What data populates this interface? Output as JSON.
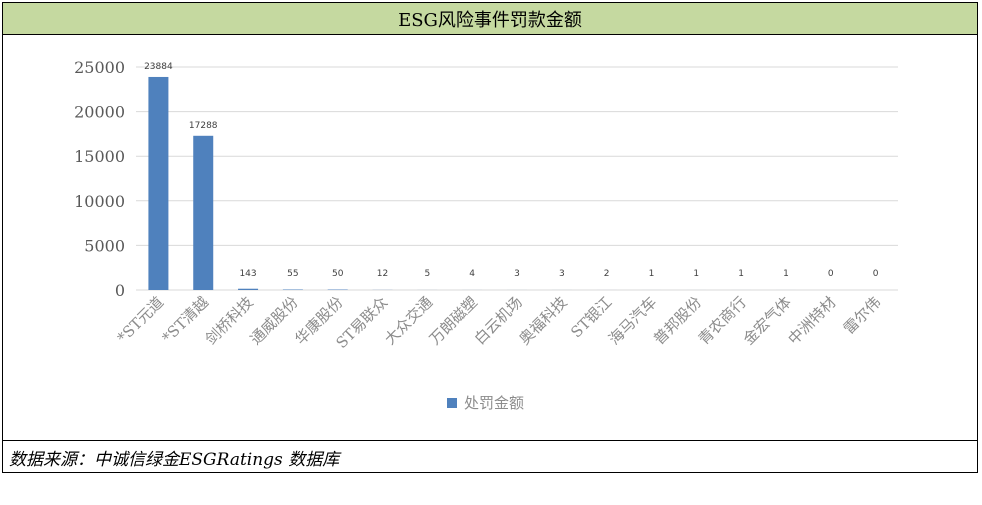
{
  "header": {
    "title": "ESG风险事件罚款金额"
  },
  "footer": {
    "source": "数据来源：中诚信绿金ESGRatings 数据库"
  },
  "colors": {
    "bar": "#4f81bd",
    "grid": "#d9d9d9",
    "axis_text": "#595959",
    "label_text": "#404040",
    "header_bg": "#c5d9a0"
  },
  "chart_data": {
    "type": "bar",
    "title": "",
    "xlabel": "",
    "ylabel": "",
    "ylim": [
      0,
      25000
    ],
    "yticks": [
      0,
      5000,
      10000,
      15000,
      20000,
      25000
    ],
    "grid": true,
    "legend_position": "bottom",
    "categories": [
      "*ST元道",
      "*ST清越",
      "剑桥科技",
      "通威股份",
      "华康股份",
      "ST易联众",
      "大众交通",
      "万朗磁塑",
      "白云机场",
      "奥福科技",
      "ST银江",
      "海马汽车",
      "普邦股份",
      "青农商行",
      "金宏气体",
      "中洲特材",
      "雷尔伟"
    ],
    "series": [
      {
        "name": "处罚金额",
        "values": [
          23884,
          17288,
          143,
          55,
          50,
          12,
          5,
          4,
          3,
          3,
          2,
          1,
          1,
          1,
          1,
          0,
          0
        ]
      }
    ]
  }
}
